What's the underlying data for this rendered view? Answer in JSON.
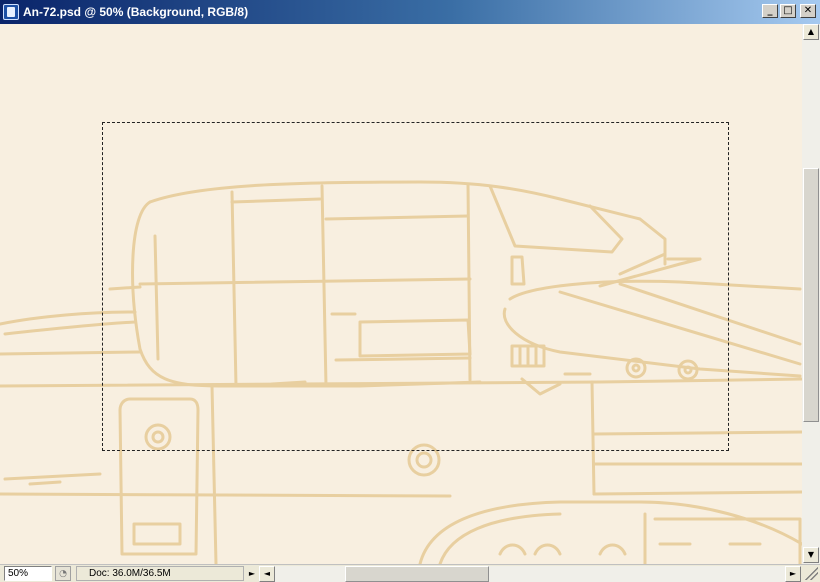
{
  "window": {
    "title": "An-72.psd @ 50% (Background, RGB/8)",
    "icon": "photoshop-document-icon",
    "buttons": {
      "minimize_glyph": "_",
      "maximize_glyph": "□",
      "close_glyph": "✕"
    }
  },
  "canvas": {
    "background_color": "#f8efe0",
    "line_color": "#e8cfa0",
    "selection": "marquee-selection"
  },
  "scrollbars": {
    "up_glyph": "▲",
    "down_glyph": "▼",
    "left_glyph": "◄",
    "right_glyph": "►"
  },
  "status": {
    "zoom": "50%",
    "doc_info": "Doc: 36.0M/36.5M",
    "menu_arrow": "►",
    "icon": "status-info-icon"
  }
}
